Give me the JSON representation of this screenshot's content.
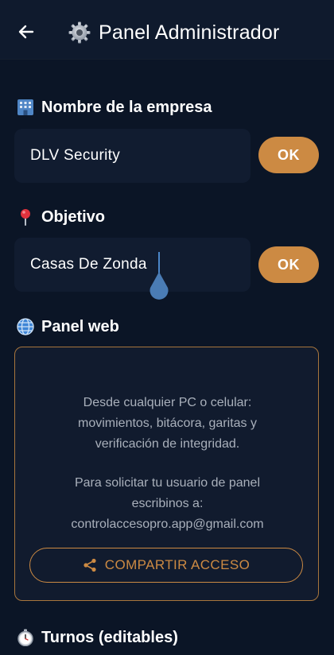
{
  "appbar": {
    "title": "Panel Administrador",
    "back_icon": "arrow-left-icon",
    "title_icon": "gear-icon"
  },
  "company": {
    "heading": "Nombre de la empresa",
    "heading_icon": "office-building-icon",
    "value": "DLV Security",
    "ok_label": "OK"
  },
  "objective": {
    "heading": "Objetivo",
    "heading_icon": "pin-icon",
    "value": "Casas De Zonda",
    "ok_label": "OK"
  },
  "web_panel": {
    "heading": "Panel web",
    "heading_icon": "globe-icon",
    "description_lines": [
      "Desde cualquier PC o celular:",
      "movimientos, bitácora, garitas y",
      "verificación de integridad."
    ],
    "request_lines": [
      "Para solicitar tu usuario de panel",
      "escribinos a:",
      "controlaccesopro.app@gmail.com"
    ],
    "share_label": "COMPARTIR ACCESO",
    "share_icon": "share-icon"
  },
  "shifts": {
    "heading": "Turnos (editables)",
    "heading_icon": "stopwatch-icon"
  },
  "colors": {
    "background": "#0b1526",
    "appbar": "#0f1a2d",
    "field": "#111c30",
    "accent": "#cc8a43",
    "card_border": "#a8763d",
    "muted_text": "#a9b0bb",
    "caret": "#4a86c8"
  }
}
